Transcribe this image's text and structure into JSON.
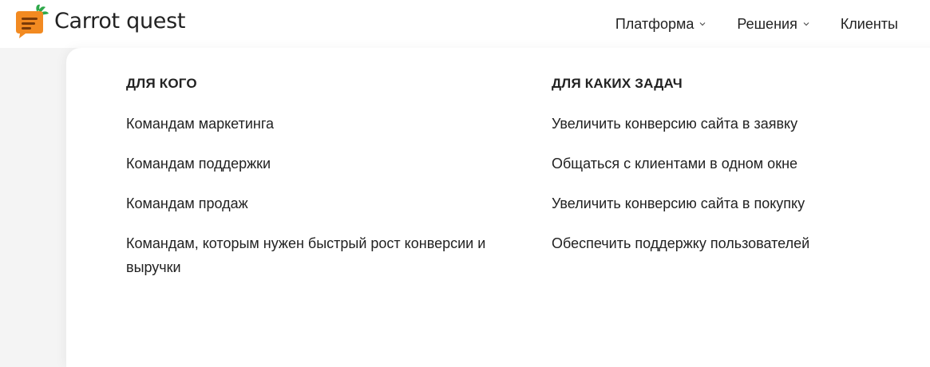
{
  "header": {
    "logo_text": "Carrot quest",
    "nav": [
      {
        "label": "Платформа",
        "has_dropdown": true
      },
      {
        "label": "Решения",
        "has_dropdown": true
      },
      {
        "label": "Клиенты",
        "has_dropdown": false
      }
    ]
  },
  "dropdown": {
    "left_column": {
      "title": "ДЛЯ КОГО",
      "items": [
        "Командам маркетинга",
        "Командам поддержки",
        "Командам продаж",
        "Командам, которым нужен быстрый рост конверсии и выручки"
      ]
    },
    "right_column": {
      "title": "ДЛЯ КАКИХ ЗАДАЧ",
      "items": [
        "Увеличить конверсию сайта в заявку",
        "Общаться с клиентами в одном окне",
        "Увеличить конверсию сайта в покупку",
        "Обеспечить поддержку пользователей"
      ]
    }
  },
  "colors": {
    "brand_orange": "#f28a21",
    "brand_green": "#2ea84a",
    "text": "#222222"
  },
  "icons": {
    "logo": "carrot-chat-icon",
    "dropdown": "chevron-down-icon"
  }
}
